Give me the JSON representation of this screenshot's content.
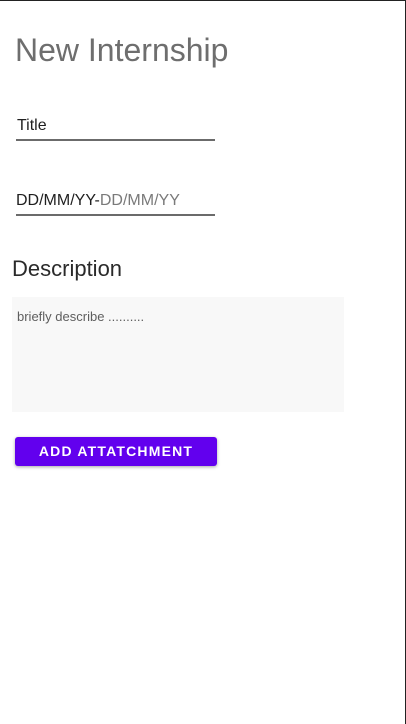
{
  "header": {
    "title": "New Internship"
  },
  "form": {
    "title_field": {
      "value": "Title"
    },
    "date_field": {
      "value": "DD/MM/YY-",
      "placeholder": "DD/MM/YY"
    },
    "description": {
      "label": "Description",
      "placeholder": "briefly describe .........."
    },
    "attach_button_label": "ADD ATTATCHMENT"
  },
  "colors": {
    "accent": "#6200ee",
    "title_text": "#6e6e6e",
    "underline": "#6b6b6b",
    "text_area_bg": "#f8f8f8"
  }
}
